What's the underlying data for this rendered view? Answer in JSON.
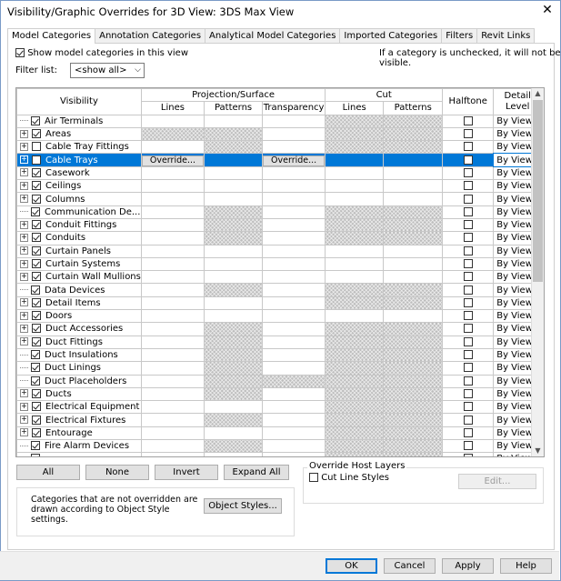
{
  "window": {
    "title": "Visibility/Graphic Overrides for 3D View: 3DS Max View",
    "close_label": "✕"
  },
  "tabs": [
    {
      "label": "Model Categories",
      "active": true
    },
    {
      "label": "Annotation Categories"
    },
    {
      "label": "Analytical Model Categories"
    },
    {
      "label": "Imported Categories"
    },
    {
      "label": "Filters"
    },
    {
      "label": "Revit Links"
    }
  ],
  "show_model": {
    "label": "Show model categories in this view",
    "checked": true
  },
  "hint": "If a category is unchecked, it will not be visible.",
  "filter": {
    "label": "Filter list:",
    "value": "<show all>"
  },
  "columns": {
    "visibility": "Visibility",
    "projection_group": "Projection/Surface",
    "cut_group": "Cut",
    "halftone": "Halftone",
    "detail_level_1": "Detail",
    "detail_level_2": "Level",
    "lines": "Lines",
    "patterns": "Patterns",
    "transparency": "Transparency",
    "cut_lines": "Lines",
    "cut_patterns": "Patterns"
  },
  "override_label": "Override...",
  "detail_value": "By View",
  "rows": [
    {
      "name": "Air Terminals",
      "expand": false,
      "checked": true,
      "hatch": [
        0,
        0,
        0,
        1,
        1
      ]
    },
    {
      "name": "Areas",
      "expand": true,
      "checked": true,
      "hatch": [
        1,
        1,
        0,
        1,
        1
      ]
    },
    {
      "name": "Cable Tray Fittings",
      "expand": true,
      "checked": false,
      "hatch": [
        0,
        1,
        0,
        1,
        1
      ]
    },
    {
      "name": "Cable Trays",
      "expand": true,
      "checked": false,
      "hatch": [
        0,
        0,
        0,
        0,
        0
      ],
      "selected": true
    },
    {
      "name": "Casework",
      "expand": true,
      "checked": true,
      "hatch": [
        0,
        0,
        0,
        0,
        0
      ]
    },
    {
      "name": "Ceilings",
      "expand": true,
      "checked": true,
      "hatch": [
        0,
        0,
        0,
        0,
        0
      ]
    },
    {
      "name": "Columns",
      "expand": true,
      "checked": true,
      "hatch": [
        0,
        0,
        0,
        0,
        0
      ]
    },
    {
      "name": "Communication De...",
      "expand": false,
      "checked": true,
      "hatch": [
        0,
        1,
        0,
        1,
        1
      ]
    },
    {
      "name": "Conduit Fittings",
      "expand": true,
      "checked": true,
      "hatch": [
        0,
        1,
        0,
        1,
        1
      ]
    },
    {
      "name": "Conduits",
      "expand": true,
      "checked": true,
      "hatch": [
        0,
        1,
        0,
        1,
        1
      ]
    },
    {
      "name": "Curtain Panels",
      "expand": true,
      "checked": true,
      "hatch": [
        0,
        0,
        0,
        0,
        0
      ]
    },
    {
      "name": "Curtain Systems",
      "expand": true,
      "checked": true,
      "hatch": [
        0,
        0,
        0,
        0,
        0
      ]
    },
    {
      "name": "Curtain Wall Mullions",
      "expand": true,
      "checked": true,
      "hatch": [
        0,
        0,
        0,
        0,
        0
      ]
    },
    {
      "name": "Data Devices",
      "expand": false,
      "checked": true,
      "hatch": [
        0,
        1,
        0,
        1,
        1
      ]
    },
    {
      "name": "Detail Items",
      "expand": true,
      "checked": true,
      "hatch": [
        0,
        0,
        0,
        1,
        1
      ]
    },
    {
      "name": "Doors",
      "expand": true,
      "checked": true,
      "hatch": [
        0,
        0,
        0,
        0,
        0
      ]
    },
    {
      "name": "Duct Accessories",
      "expand": true,
      "checked": true,
      "hatch": [
        0,
        1,
        0,
        1,
        1
      ]
    },
    {
      "name": "Duct Fittings",
      "expand": true,
      "checked": true,
      "hatch": [
        0,
        1,
        0,
        1,
        1
      ]
    },
    {
      "name": "Duct Insulations",
      "expand": false,
      "checked": true,
      "hatch": [
        0,
        1,
        0,
        1,
        1
      ]
    },
    {
      "name": "Duct Linings",
      "expand": false,
      "checked": true,
      "hatch": [
        0,
        1,
        0,
        1,
        1
      ]
    },
    {
      "name": "Duct Placeholders",
      "expand": false,
      "checked": true,
      "hatch": [
        0,
        1,
        1,
        1,
        1
      ]
    },
    {
      "name": "Ducts",
      "expand": true,
      "checked": true,
      "hatch": [
        0,
        1,
        0,
        1,
        1
      ]
    },
    {
      "name": "Electrical Equipment",
      "expand": true,
      "checked": true,
      "hatch": [
        0,
        0,
        0,
        1,
        1
      ]
    },
    {
      "name": "Electrical Fixtures",
      "expand": true,
      "checked": true,
      "hatch": [
        0,
        1,
        0,
        1,
        1
      ]
    },
    {
      "name": "Entourage",
      "expand": true,
      "checked": true,
      "hatch": [
        0,
        0,
        0,
        1,
        1
      ]
    },
    {
      "name": "Fire Alarm Devices",
      "expand": false,
      "checked": true,
      "hatch": [
        0,
        1,
        0,
        1,
        1
      ]
    },
    {
      "name": "",
      "expand": false,
      "checked": true,
      "hatch": [
        0,
        0,
        0,
        1,
        1
      ]
    }
  ],
  "buttons": {
    "all": "All",
    "none": "None",
    "invert": "Invert",
    "expand_all": "Expand All",
    "object_styles": "Object Styles...",
    "edit": "Edit...",
    "ok": "OK",
    "cancel": "Cancel",
    "apply": "Apply",
    "help": "Help"
  },
  "host_layers": {
    "title": "Override Host Layers",
    "cut_line_styles": "Cut Line Styles",
    "checked": false
  },
  "note": "Categories that are not overridden are drawn according to Object Style settings."
}
